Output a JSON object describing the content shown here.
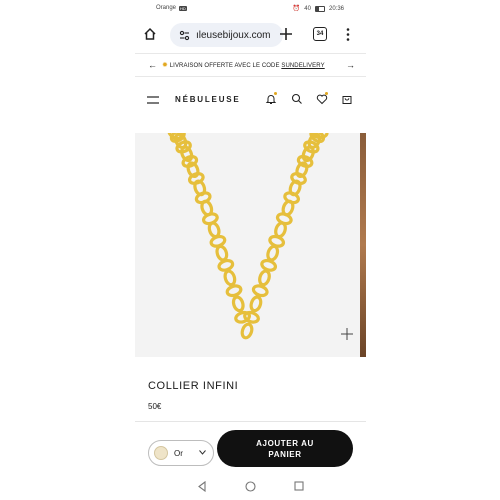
{
  "status_bar": {
    "carrier": "Orange",
    "network": "HD",
    "battery": "40",
    "time": "20:36"
  },
  "browser": {
    "url": "ıleusebijoux.com",
    "tab_count": "34"
  },
  "promo": {
    "text": "LIVRAISON OFFERTE AVEC LE CODE",
    "code": "SUNDELIVERY"
  },
  "site": {
    "logo": "NÉBULEUSE"
  },
  "product": {
    "title": "COLLIER INFINI",
    "price": "50€",
    "variant": "Or",
    "add_to_cart": "AJOUTER AU\nPANIER"
  },
  "colors": {
    "accent": "#e2a820",
    "button": "#111111",
    "gold": "#e6bf3c"
  }
}
